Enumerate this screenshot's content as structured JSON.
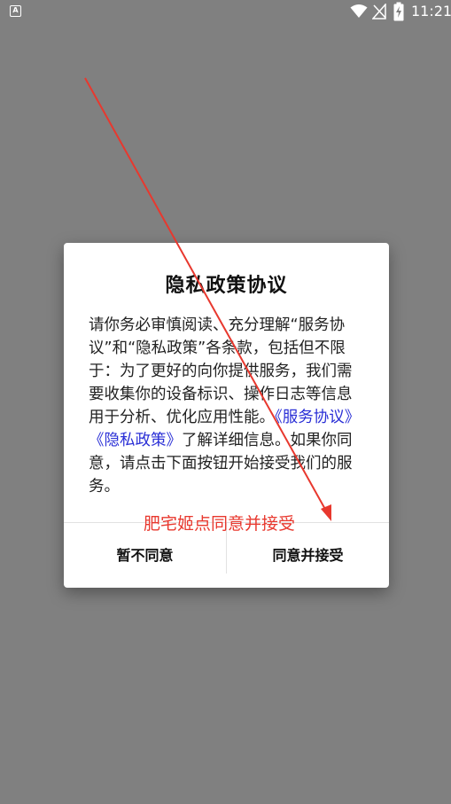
{
  "status_bar": {
    "app_icon_letter": "A",
    "time": "11:21",
    "icons": [
      "wifi-icon",
      "no-signal-icon",
      "battery-charging-icon"
    ]
  },
  "dialog": {
    "title": "隐私政策协议",
    "body_prefix": "请你务必审慎阅读、充分理解“服务协议”和“隐私政策”各条款，包括但不限于：为了更好的向你提供服务，我们需要收集你的设备标识、操作日志等信息用于分析、优化应用性能。",
    "link_service": "《服务协议》",
    "link_privacy": "《隐私政策》",
    "body_suffix": "了解详细信息。如果你同意，请点击下面按钮开始接受我们的服务。",
    "decline_label": "暂不同意",
    "accept_label": "同意并接受"
  },
  "annotation": {
    "label": "肥宅姬点同意并接受",
    "color": "#e8382e"
  },
  "colors": {
    "overlay": "#808080",
    "link": "#2a2fd6"
  }
}
